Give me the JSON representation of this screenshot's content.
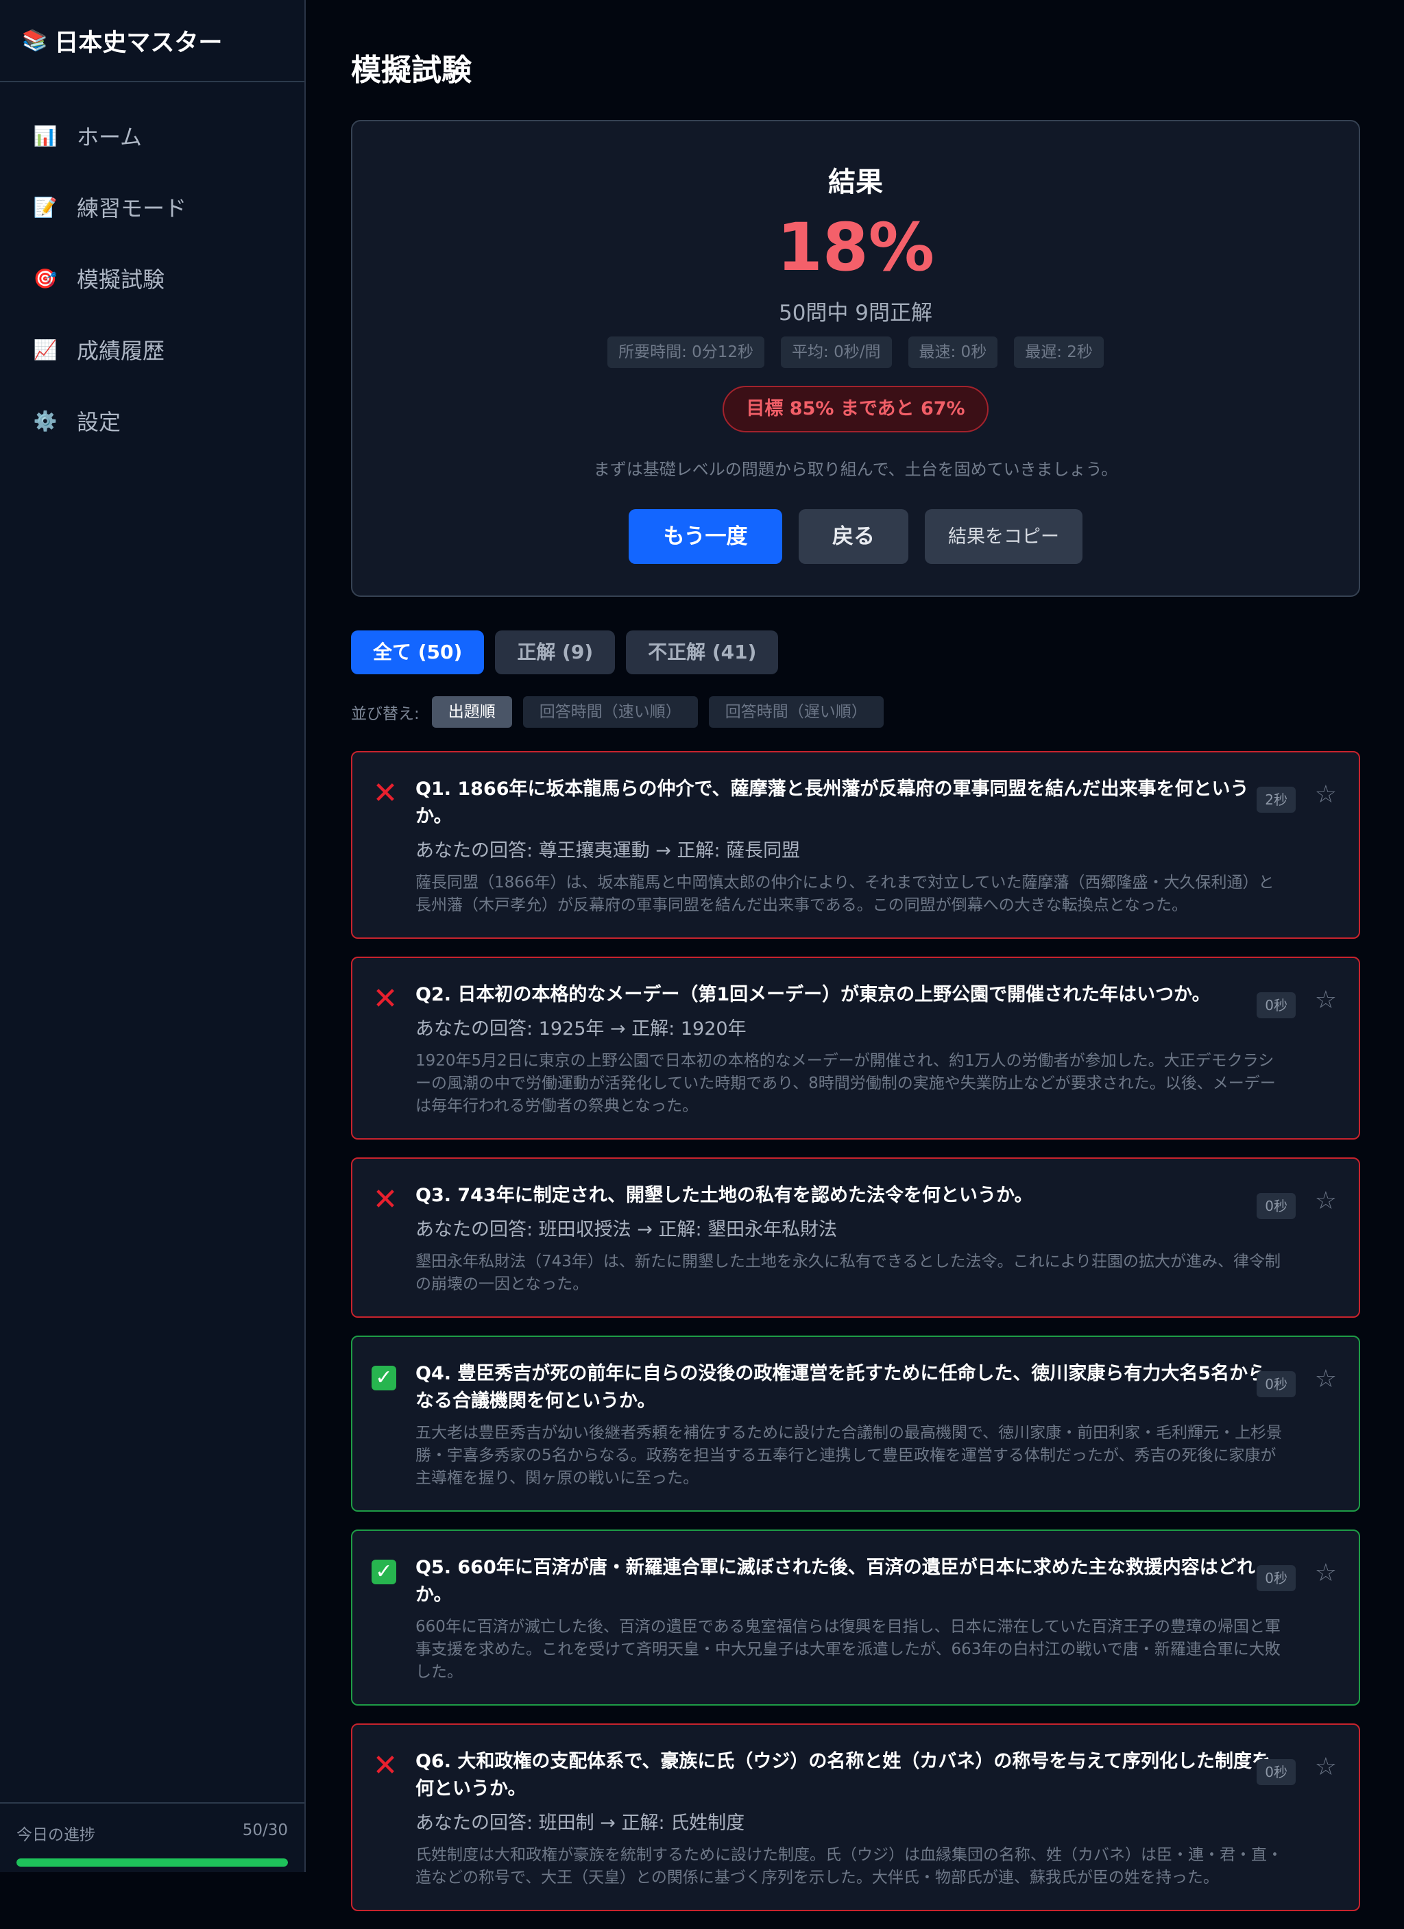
{
  "app": {
    "title": "日本史マスター"
  },
  "sidebar": {
    "items": [
      {
        "label": "ホーム",
        "icon": "bar-chart-icon",
        "glyph": "📊"
      },
      {
        "label": "練習モード",
        "icon": "memo-icon",
        "glyph": "📝"
      },
      {
        "label": "模擬試験",
        "icon": "target-icon",
        "glyph": "🎯"
      },
      {
        "label": "成績履歴",
        "icon": "trend-chart-icon",
        "glyph": "📈"
      },
      {
        "label": "設定",
        "icon": "gear-icon",
        "glyph": "⚙️"
      }
    ],
    "progress": {
      "label": "今日の進捗",
      "value_text": "50/30",
      "fraction": 1.0,
      "color": "#1ec25a"
    }
  },
  "page": {
    "title": "模擬試験"
  },
  "result": {
    "heading": "結果",
    "score": "18%",
    "summary": "50問中 9問正解",
    "stats": [
      "所要時間: 0分12秒",
      "平均: 0秒/問",
      "最速: 0秒",
      "最遅: 2秒"
    ],
    "goal": "目標 85% まであと 67%",
    "advice": "まずは基礎レベルの問題から取り組んで、土台を固めていきましょう。",
    "buttons": {
      "retry": "もう一度",
      "back": "戻る",
      "copy": "結果をコピー"
    }
  },
  "filters": {
    "tabs": [
      {
        "label": "全て (50)",
        "active": true
      },
      {
        "label": "正解 (9)",
        "active": false
      },
      {
        "label": "不正解 (41)",
        "active": false
      }
    ]
  },
  "sort": {
    "label": "並び替え:",
    "options": [
      {
        "label": "出題順",
        "active": true
      },
      {
        "label": "回答時間（速い順）",
        "active": false
      },
      {
        "label": "回答時間（遅い順）",
        "active": false
      }
    ]
  },
  "questions": [
    {
      "correct": false,
      "text": "Q1. 1866年に坂本龍馬らの仲介で、薩摩藩と長州藩が反幕府の軍事同盟を結んだ出来事を何というか。",
      "answer": "あなたの回答: 尊王攘夷運動 → 正解: 薩長同盟",
      "explanation": "薩長同盟（1866年）は、坂本龍馬と中岡慎太郎の仲介により、それまで対立していた薩摩藩（西郷隆盛・大久保利通）と長州藩（木戸孝允）が反幕府の軍事同盟を結んだ出来事である。この同盟が倒幕への大きな転換点となった。",
      "time": "2秒"
    },
    {
      "correct": false,
      "text": "Q2. 日本初の本格的なメーデー（第1回メーデー）が東京の上野公園で開催された年はいつか。",
      "answer": "あなたの回答: 1925年 → 正解: 1920年",
      "explanation": "1920年5月2日に東京の上野公園で日本初の本格的なメーデーが開催され、約1万人の労働者が参加した。大正デモクラシーの風潮の中で労働運動が活発化していた時期であり、8時間労働制の実施や失業防止などが要求された。以後、メーデーは毎年行われる労働者の祭典となった。",
      "time": "0秒"
    },
    {
      "correct": false,
      "text": "Q3. 743年に制定され、開墾した土地の私有を認めた法令を何というか。",
      "answer": "あなたの回答: 班田収授法 → 正解: 墾田永年私財法",
      "explanation": "墾田永年私財法（743年）は、新たに開墾した土地を永久に私有できるとした法令。これにより荘園の拡大が進み、律令制の崩壊の一因となった。",
      "time": "0秒"
    },
    {
      "correct": true,
      "text": "Q4. 豊臣秀吉が死の前年に自らの没後の政権運営を託すために任命した、徳川家康ら有力大名5名からなる合議機関を何というか。",
      "answer": "",
      "explanation": "五大老は豊臣秀吉が幼い後継者秀頼を補佐するために設けた合議制の最高機関で、徳川家康・前田利家・毛利輝元・上杉景勝・宇喜多秀家の5名からなる。政務を担当する五奉行と連携して豊臣政権を運営する体制だったが、秀吉の死後に家康が主導権を握り、関ヶ原の戦いに至った。",
      "time": "0秒"
    },
    {
      "correct": true,
      "text": "Q5. 660年に百済が唐・新羅連合軍に滅ぼされた後、百済の遺臣が日本に求めた主な救援内容はどれか。",
      "answer": "",
      "explanation": "660年に百済が滅亡した後、百済の遺臣である鬼室福信らは復興を目指し、日本に滞在していた百済王子の豊璋の帰国と軍事支援を求めた。これを受けて斉明天皇・中大兄皇子は大軍を派遣したが、663年の白村江の戦いで唐・新羅連合軍に大敗した。",
      "time": "0秒"
    },
    {
      "correct": false,
      "text": "Q6. 大和政権の支配体系で、豪族に氏（ウジ）の名称と姓（カバネ）の称号を与えて序列化した制度を何というか。",
      "answer": "あなたの回答: 班田制 → 正解: 氏姓制度",
      "explanation": "氏姓制度は大和政権が豪族を統制するために設けた制度。氏（ウジ）は血縁集団の名称、姓（カバネ）は臣・連・君・直・造などの称号で、大王（天皇）との関係に基づく序列を示した。大伴氏・物部氏が連、蘇我氏が臣の姓を持った。",
      "time": "0秒"
    }
  ]
}
